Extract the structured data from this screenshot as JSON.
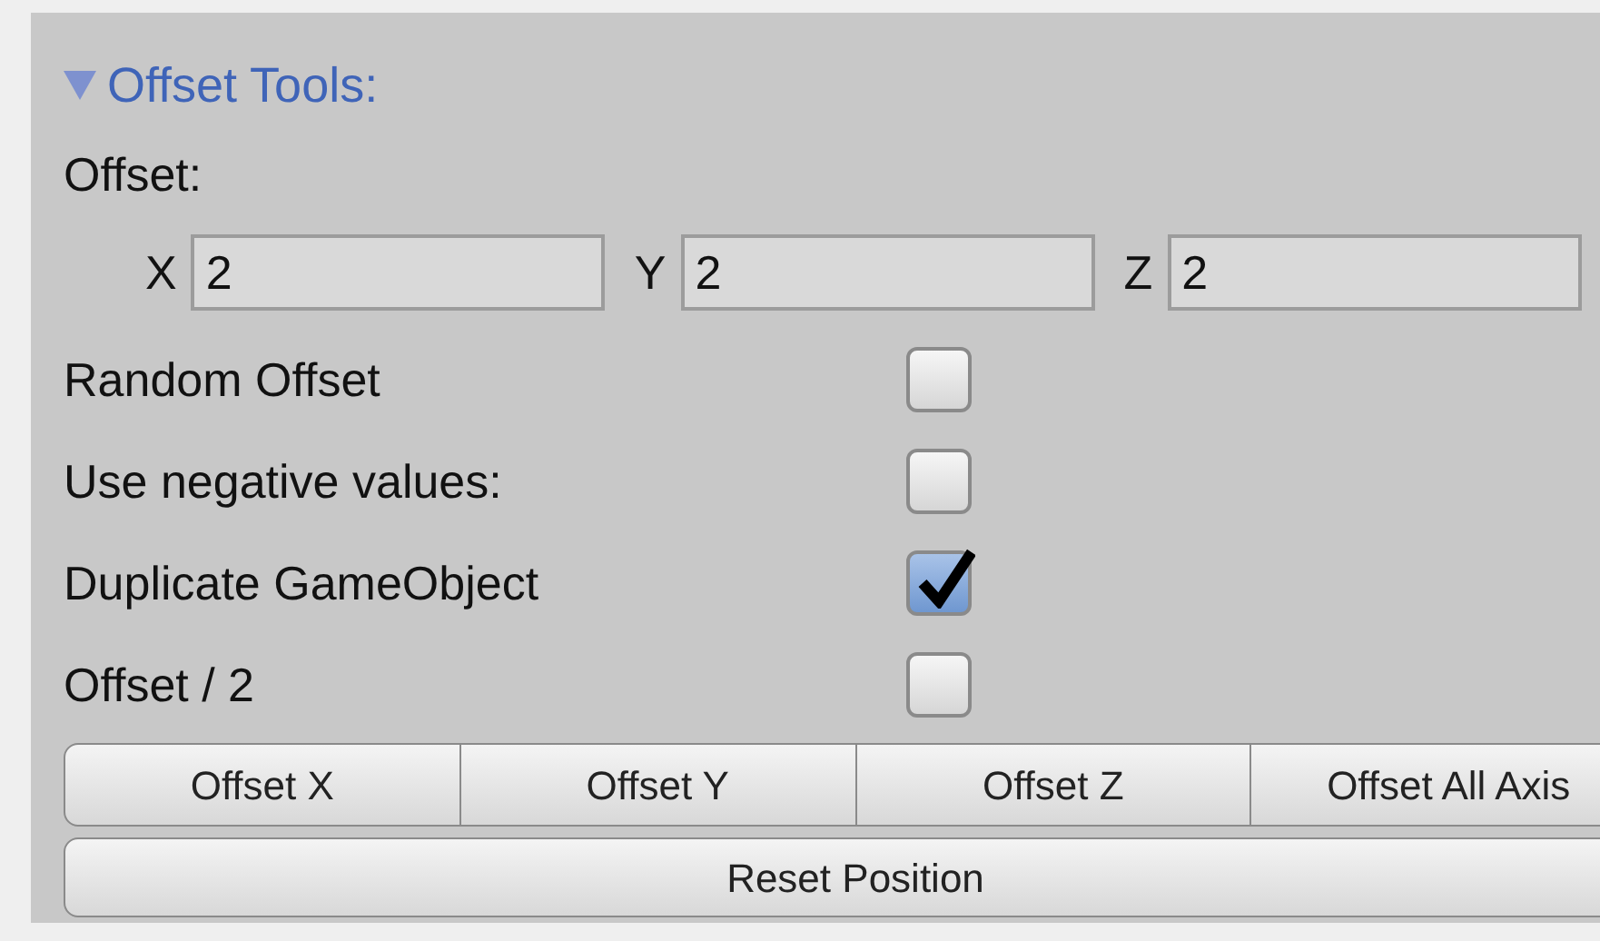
{
  "section": {
    "title": "Offset Tools:",
    "expanded": true
  },
  "offset": {
    "label": "Offset:",
    "fields": [
      {
        "axis": "X",
        "value": "2"
      },
      {
        "axis": "Y",
        "value": "2"
      },
      {
        "axis": "Z",
        "value": "2"
      }
    ]
  },
  "options": [
    {
      "label": "Random Offset",
      "checked": false
    },
    {
      "label": "Use negative values:",
      "checked": false
    },
    {
      "label": "Duplicate GameObject",
      "checked": true
    },
    {
      "label": "Offset / 2",
      "checked": false
    }
  ],
  "axis_buttons": [
    "Offset X",
    "Offset Y",
    "Offset Z",
    "Offset All Axis"
  ],
  "reset_button": "Reset Position"
}
